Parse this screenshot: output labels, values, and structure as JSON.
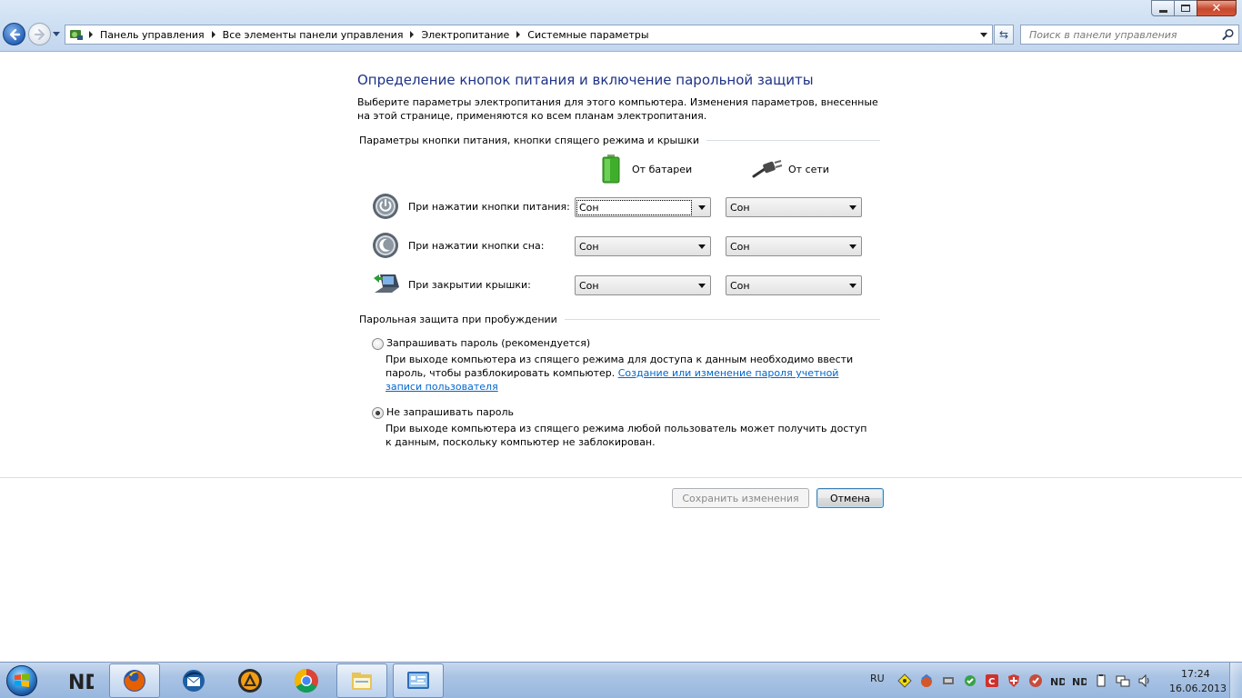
{
  "window": {
    "caption_buttons": [
      "minimize",
      "maximize",
      "close"
    ]
  },
  "address_bar": {
    "icon": "control-panel-icon",
    "breadcrumbs": [
      "Панель управления",
      "Все элементы панели управления",
      "Электропитание",
      "Системные параметры"
    ]
  },
  "search": {
    "placeholder": "Поиск в панели управления"
  },
  "page": {
    "title": "Определение кнопок питания и включение парольной защиты",
    "description": "Выберите параметры электропитания для этого компьютера. Изменения параметров, внесенные на этой странице, применяются ко всем планам электропитания."
  },
  "buttons_group": {
    "heading": "Параметры кнопки питания, кнопки спящего режима и крышки",
    "col_battery": "От батареи",
    "col_ac": "От сети",
    "rows": [
      {
        "label": "При нажатии кнопки питания:",
        "battery": "Сон",
        "ac": "Сон",
        "icon": "power-button-icon"
      },
      {
        "label": "При нажатии кнопки сна:",
        "battery": "Сон",
        "ac": "Сон",
        "icon": "sleep-button-icon"
      },
      {
        "label": "При закрытии крышки:",
        "battery": "Сон",
        "ac": "Сон",
        "icon": "laptop-lid-icon"
      }
    ]
  },
  "password_group": {
    "heading": "Парольная защита при пробуждении",
    "options": [
      {
        "label": "Запрашивать пароль (рекомендуется)",
        "checked": false,
        "desc_text": "При выходе компьютера из спящего режима для доступа к данным необходимо ввести пароль, чтобы разблокировать компьютер. ",
        "link": "Создание или изменение пароля учетной записи пользователя"
      },
      {
        "label": "Не запрашивать пароль",
        "checked": true,
        "desc_text": "При выходе компьютера из спящего режима любой пользователь может получить доступ к данным, поскольку компьютер не заблокирован."
      }
    ]
  },
  "actions": {
    "save": "Сохранить изменения",
    "cancel": "Отмена",
    "save_enabled": false
  },
  "taskbar": {
    "apps": [
      "nd-app-icon",
      "firefox-icon",
      "thunderbird-icon",
      "aimp-icon",
      "chrome-icon",
      "explorer-icon",
      "control-panel-icon"
    ],
    "active_apps": [
      "firefox-icon",
      "explorer-icon",
      "control-panel-icon"
    ],
    "language": "RU",
    "time": "17:24",
    "date": "16.06.2013"
  },
  "colors": {
    "title": "#1e3287",
    "link": "#0066cc",
    "taskbar": "#a9c3e4"
  }
}
